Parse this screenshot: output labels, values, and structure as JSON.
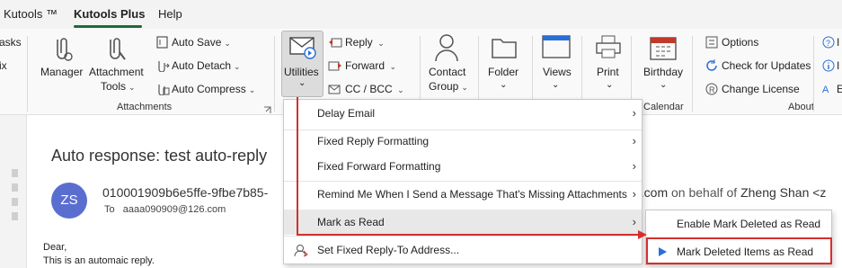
{
  "tabs": {
    "kutools": "Kutools ™",
    "kutools_plus": "Kutools Plus",
    "help": "Help"
  },
  "ribbon": {
    "left_partial": {
      "tasks": "asks",
      "fix": "ix"
    },
    "manager": "Manager",
    "attachment_tools_line1": "Attachment",
    "attachment_tools_line2": "Tools",
    "auto_save": "Auto Save",
    "auto_detach": "Auto Detach",
    "auto_compress": "Auto Compress",
    "attachments_group": "Attachments",
    "utilities": "Utilities",
    "reply": "Reply",
    "forward": "Forward",
    "cc_bcc": "CC / BCC",
    "contact_group_line1": "Contact",
    "contact_group_line2": "Group",
    "folder": "Folder",
    "views": "Views",
    "print": "Print",
    "birthday": "Birthday",
    "calendar_group": "Calendar",
    "options": "Options",
    "check_updates": "Check for Updates",
    "change_license": "Change License",
    "about_group": "About"
  },
  "message": {
    "subject": "Auto response: test auto-reply",
    "avatar_initials": "ZS",
    "sender_address": "010001909b6e5ffe-9fbe7b85-",
    "sender_domain_tail": "e.com",
    "on_behalf_of": "on behalf of",
    "on_behalf_name": "Zheng Shan <z",
    "to_label": "To",
    "to_address": "aaaa090909@126.com",
    "body_line1": "Dear,",
    "body_line2": "This is an automaic reply."
  },
  "menu": {
    "items": [
      {
        "label": "Delay Email"
      },
      {
        "label": "Fixed Reply Formatting"
      },
      {
        "label": "Fixed Forward Formatting"
      },
      {
        "label": "Remind Me When I Send a Message That's Missing Attachments"
      },
      {
        "label": "Mark as Read"
      },
      {
        "label": "Set Fixed Reply-To Address..."
      }
    ],
    "submenu": [
      {
        "label": "Enable Mark Deleted as Read"
      },
      {
        "label": "Mark Deleted Items as Read"
      }
    ]
  },
  "colors": {
    "accent": "#1e6a3a",
    "highlight": "#d62f2f",
    "avatar": "#5a6ed0"
  }
}
